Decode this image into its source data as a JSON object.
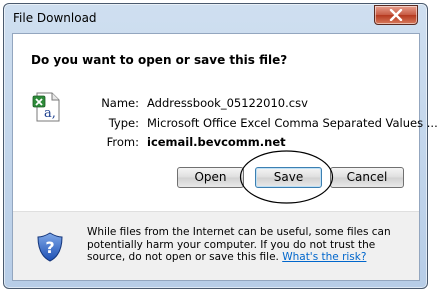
{
  "window": {
    "title": "File Download"
  },
  "dialog": {
    "question": "Do you want to open or save this file?",
    "fields": [
      {
        "label": "Name:",
        "value": "Addressbook_05122010.csv"
      },
      {
        "label": "Type:",
        "value": "Microsoft Office Excel Comma Separated Values ..."
      },
      {
        "label": "From:",
        "value": "icemail.bevcomm.net"
      }
    ],
    "buttons": {
      "open": "Open",
      "save": "Save",
      "cancel": "Cancel"
    },
    "file_icon": "excel-csv-file-icon"
  },
  "footer": {
    "text": "While files from the Internet can be useful, some files can potentially harm your computer. If you do not trust the source, do not open or save this file.",
    "link": "What's the risk?",
    "icon": "security-shield-question-icon"
  }
}
